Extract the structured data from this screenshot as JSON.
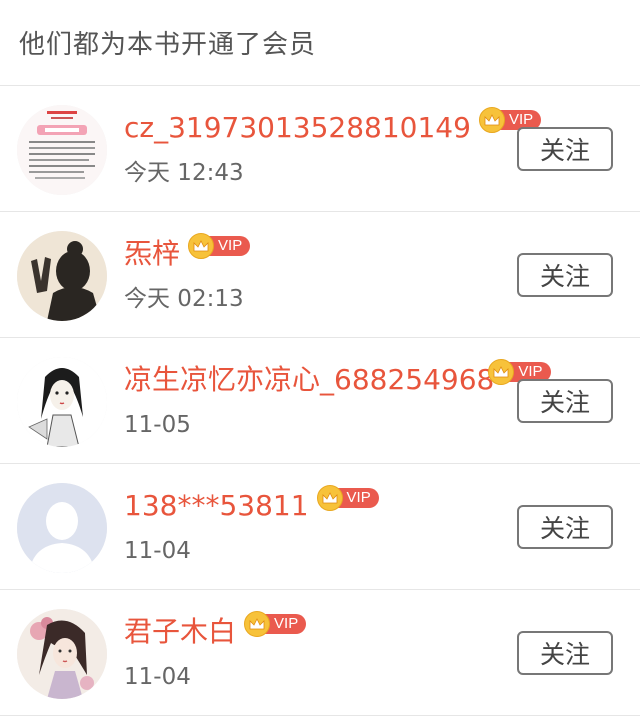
{
  "header": {
    "title": "他们都为本书开通了会员"
  },
  "members": [
    {
      "name": "cz_31973013528810149",
      "time": "今天 12:43",
      "vip": "VIP",
      "follow": "关注",
      "avatar": "screenshot-avatar"
    },
    {
      "name": "炁梓",
      "time": "今天 02:13",
      "vip": "VIP",
      "follow": "关注",
      "avatar": "silhouette-avatar"
    },
    {
      "name": "凉生凉忆亦凉心_688254968",
      "time": "11-05",
      "vip": "VIP",
      "follow": "关注",
      "avatar": "ink-girl-avatar"
    },
    {
      "name": "138***53811",
      "time": "11-04",
      "vip": "VIP",
      "follow": "关注",
      "avatar": "default-avatar"
    },
    {
      "name": "君子木白",
      "time": "11-04",
      "vip": "VIP",
      "follow": "关注",
      "avatar": "flower-girl-avatar"
    }
  ],
  "colors": {
    "name": "#e8553c",
    "vip_badge": "#ea5a4e",
    "crown": "#f7c23a",
    "divider": "#e6e6e6"
  }
}
